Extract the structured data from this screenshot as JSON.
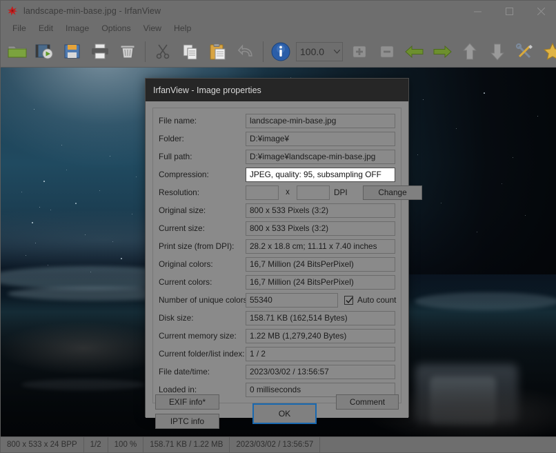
{
  "window": {
    "title": "landscape-min-base.jpg - IrfanView",
    "app_icon": "irfanview-logo-icon",
    "controls": {
      "minimize": "minimize-icon",
      "maximize": "maximize-icon",
      "close": "close-icon"
    }
  },
  "menubar": {
    "items": [
      {
        "label": "File"
      },
      {
        "label": "Edit"
      },
      {
        "label": "Image"
      },
      {
        "label": "Options"
      },
      {
        "label": "View"
      },
      {
        "label": "Help"
      }
    ]
  },
  "toolbar": {
    "zoom_value": "100.0",
    "buttons": [
      {
        "name": "open-folder-icon",
        "title": "Open"
      },
      {
        "name": "slideshow-icon",
        "title": "Slideshow"
      },
      {
        "name": "save-icon",
        "title": "Save"
      },
      {
        "name": "print-icon",
        "title": "Print"
      },
      {
        "name": "delete-icon",
        "title": "Delete"
      },
      {
        "name": "cut-icon",
        "title": "Cut"
      },
      {
        "name": "copy-icon",
        "title": "Copy"
      },
      {
        "name": "paste-icon",
        "title": "Paste"
      },
      {
        "name": "undo-icon",
        "title": "Undo"
      },
      {
        "name": "info-icon",
        "title": "Information"
      },
      {
        "name": "zoom-in-icon",
        "title": "Zoom in"
      },
      {
        "name": "zoom-out-icon",
        "title": "Zoom out"
      },
      {
        "name": "previous-icon",
        "title": "Previous"
      },
      {
        "name": "next-icon",
        "title": "Next"
      },
      {
        "name": "first-icon",
        "title": "First"
      },
      {
        "name": "last-icon",
        "title": "Last"
      },
      {
        "name": "settings-icon",
        "title": "Settings"
      },
      {
        "name": "favorites-icon",
        "title": "Favorites"
      }
    ]
  },
  "dialog": {
    "title": "IrfanView - Image properties",
    "fields": [
      {
        "label": "File name:",
        "value": "landscape-min-base.jpg",
        "focused": false
      },
      {
        "label": "Folder:",
        "value": "D:¥image¥",
        "focused": false
      },
      {
        "label": "Full path:",
        "value": "D:¥image¥landscape-min-base.jpg",
        "focused": false
      },
      {
        "label": "Compression:",
        "value": "JPEG, quality: 95, subsampling OFF",
        "focused": true
      },
      {
        "label": "Original size:",
        "value": "800 x 533  Pixels (3:2)",
        "focused": false
      },
      {
        "label": "Current size:",
        "value": "800 x 533  Pixels (3:2)",
        "focused": false
      },
      {
        "label": "Print size (from DPI):",
        "value": "28.2 x 18.8 cm; 11.11 x 7.40 inches",
        "focused": false
      },
      {
        "label": "Original colors:",
        "value": "16,7 Million   (24 BitsPerPixel)",
        "focused": false
      },
      {
        "label": "Current colors:",
        "value": "16,7 Million   (24 BitsPerPixel)",
        "focused": false
      },
      {
        "label": "Disk size:",
        "value": "158.71 KB (162,514 Bytes)",
        "focused": false
      },
      {
        "label": "Current memory size:",
        "value": "1.22  MB (1,279,240 Bytes)",
        "focused": false
      },
      {
        "label": "Current folder/list index:",
        "value": "1  /  2",
        "focused": false
      },
      {
        "label": "File date/time:",
        "value": "2023/03/02 / 13:56:57",
        "focused": false
      },
      {
        "label": "Loaded in:",
        "value": "0 milliseconds",
        "focused": false
      }
    ],
    "resolution": {
      "label": "Resolution:",
      "width_value": "",
      "height_value": "",
      "separator": "x",
      "unit": "DPI",
      "change_label": "Change"
    },
    "unique_colors": {
      "label": "Number of unique colors:",
      "value": "55340",
      "checkbox_label": "Auto count",
      "checked": true
    },
    "buttons": {
      "exif": "EXIF info*",
      "iptc": "IPTC info",
      "ok": "OK",
      "comment": "Comment"
    },
    "focus_color": "#1868b0"
  },
  "statusbar": {
    "cells": [
      "800 x 533 x 24 BPP",
      "1/2",
      "100 %",
      "158.71 KB / 1.22 MB",
      "2023/03/02 / 13:56:57"
    ]
  },
  "image": {
    "description": "night seascape with stars, waves and waterfall over dark rocks"
  }
}
